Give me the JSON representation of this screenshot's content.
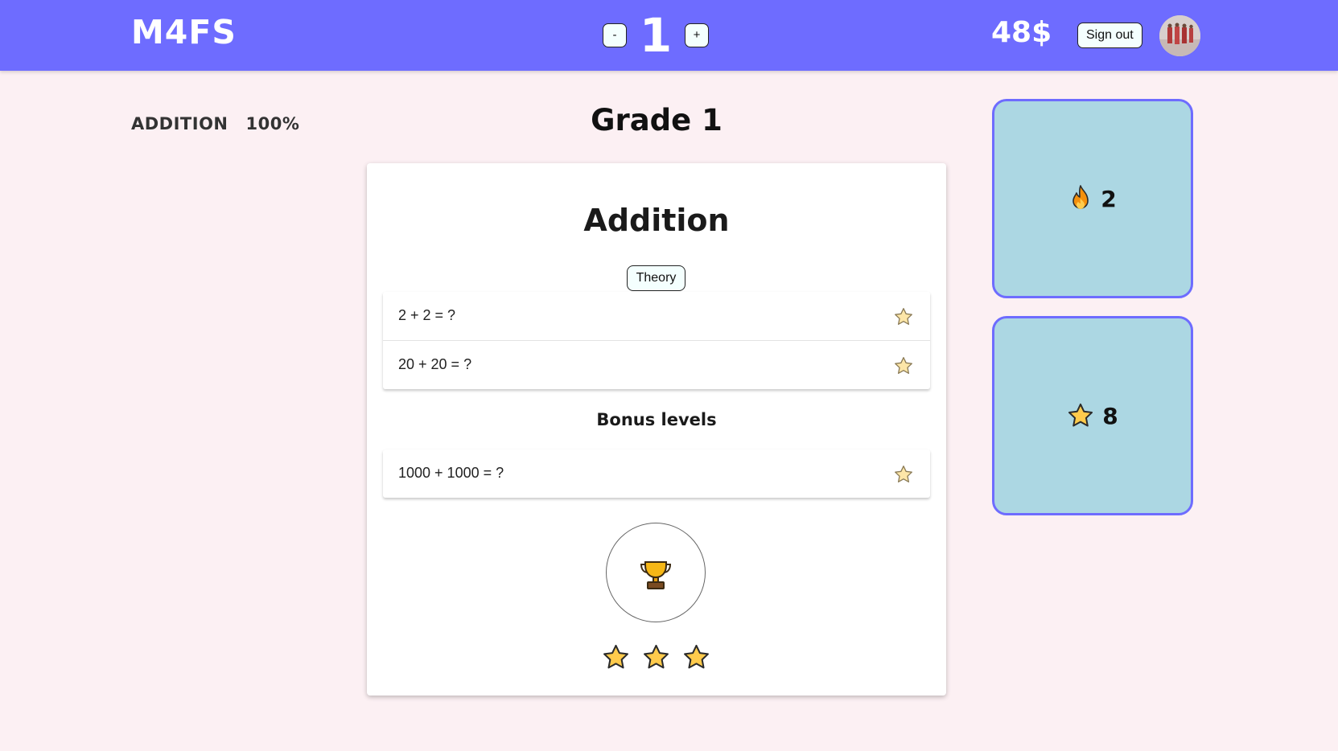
{
  "header": {
    "logo": "M4FS",
    "grade_decrease_label": "-",
    "grade_value": "1",
    "grade_increase_label": "+",
    "coins": "48$",
    "sign_out_label": "Sign out"
  },
  "progress": {
    "topic": "ADDITION",
    "percent": "100%"
  },
  "page_title": "Grade 1",
  "card": {
    "title": "Addition",
    "theory_label": "Theory",
    "levels": [
      {
        "question": "2 + 2 = ?"
      },
      {
        "question": "20 + 20 = ?"
      }
    ],
    "bonus_title": "Bonus levels",
    "bonus_levels": [
      {
        "question": "1000 + 1000 = ?"
      }
    ],
    "stars_earned": 3
  },
  "stats": {
    "streak": "2",
    "stars": "8"
  },
  "colors": {
    "header": "#6e6cff",
    "background": "#fcf0f3",
    "stat_box": "#acd7e3",
    "star_fill": "#ffcb4c"
  }
}
